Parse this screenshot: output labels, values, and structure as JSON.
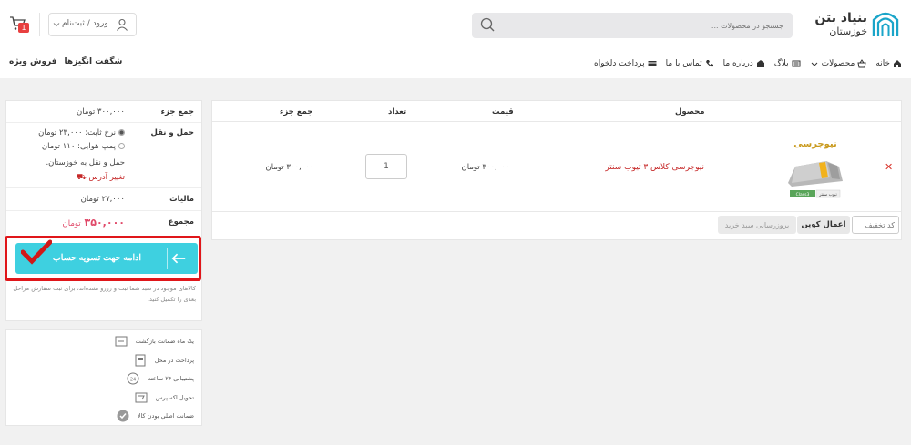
{
  "brand": {
    "title": "بنیاد بتن",
    "subtitle": "خوزستان",
    "color": "#1aa5c9"
  },
  "search": {
    "placeholder": "جستجو در محصولات ..."
  },
  "account": {
    "login_label": "ورود / ثبت‌نام"
  },
  "cart": {
    "count": "1"
  },
  "nav": {
    "items": [
      {
        "label": "خانه",
        "icon": "home-icon"
      },
      {
        "label": "محصولات",
        "icon": "basket-icon"
      },
      {
        "label": "بلاگ",
        "icon": "blog-icon"
      },
      {
        "label": "درباره ما",
        "icon": "building-icon"
      },
      {
        "label": "تماس با ما",
        "icon": "phone-icon"
      },
      {
        "label": "پرداخت دلخواه",
        "icon": "card-icon"
      }
    ],
    "left_items": [
      "فروش ویژه",
      "شگفت انگیزها"
    ]
  },
  "cart_table": {
    "headers": {
      "product": "محصول",
      "price": "قیمت",
      "qty": "تعداد",
      "subtotal": "جمع جزء"
    },
    "item": {
      "name": "نیوجرسی کلاس ۳ تیوب سنتر",
      "price": "۳۰۰,۰۰۰ تومان",
      "qty": "1",
      "subtotal": "۳۰۰,۰۰۰ تومان",
      "brand_text": "نیوجرسی",
      "tag_text": "تیوب سنتر",
      "class_text": "Class3"
    },
    "coupon_placeholder": "کد تخفیف",
    "apply_coupon": "اعمال کوپن",
    "update_cart": "بروزرسانی سبد خرید"
  },
  "totals": {
    "subtotal_label": "جمع جزء",
    "subtotal_value": "۳۰۰,۰۰۰ تومان",
    "shipping_label": "حمل و نقل",
    "shipping_option_1": "نرخ ثابت: ۲۳,۰۰۰ تومان",
    "shipping_option_2": "پمپ هوایی: ۱۱۰ تومان",
    "shipping_to": "حمل و نقل به خوزستان.",
    "change_address": "تغییر آدرس",
    "tax_label": "مالیات",
    "tax_value": "۲۷,۰۰۰ تومان",
    "total_label": "مجموع",
    "total_value": "۳۵۰,۰۰۰",
    "total_unit": "تومان",
    "checkout_label": "ادامه جهت تسویه حساب",
    "note": "کالاهای موجود در سبد شما ثبت و رزرو نشده‌اند، برای ثبت سفارش مراحل بعدی را تکمیل کنید."
  },
  "features": [
    {
      "label": "یک ماه ضمانت بازگشت",
      "icon": "return-icon"
    },
    {
      "label": "پرداخت در محل",
      "icon": "pay-on-delivery-icon"
    },
    {
      "label": "پشتیبانی ۲۴ ساعته",
      "icon": "support-icon"
    },
    {
      "label": "تحویل اکسپرس",
      "icon": "express-icon"
    },
    {
      "label": "ضمانت اصلی بودن کالا",
      "icon": "original-icon"
    }
  ]
}
